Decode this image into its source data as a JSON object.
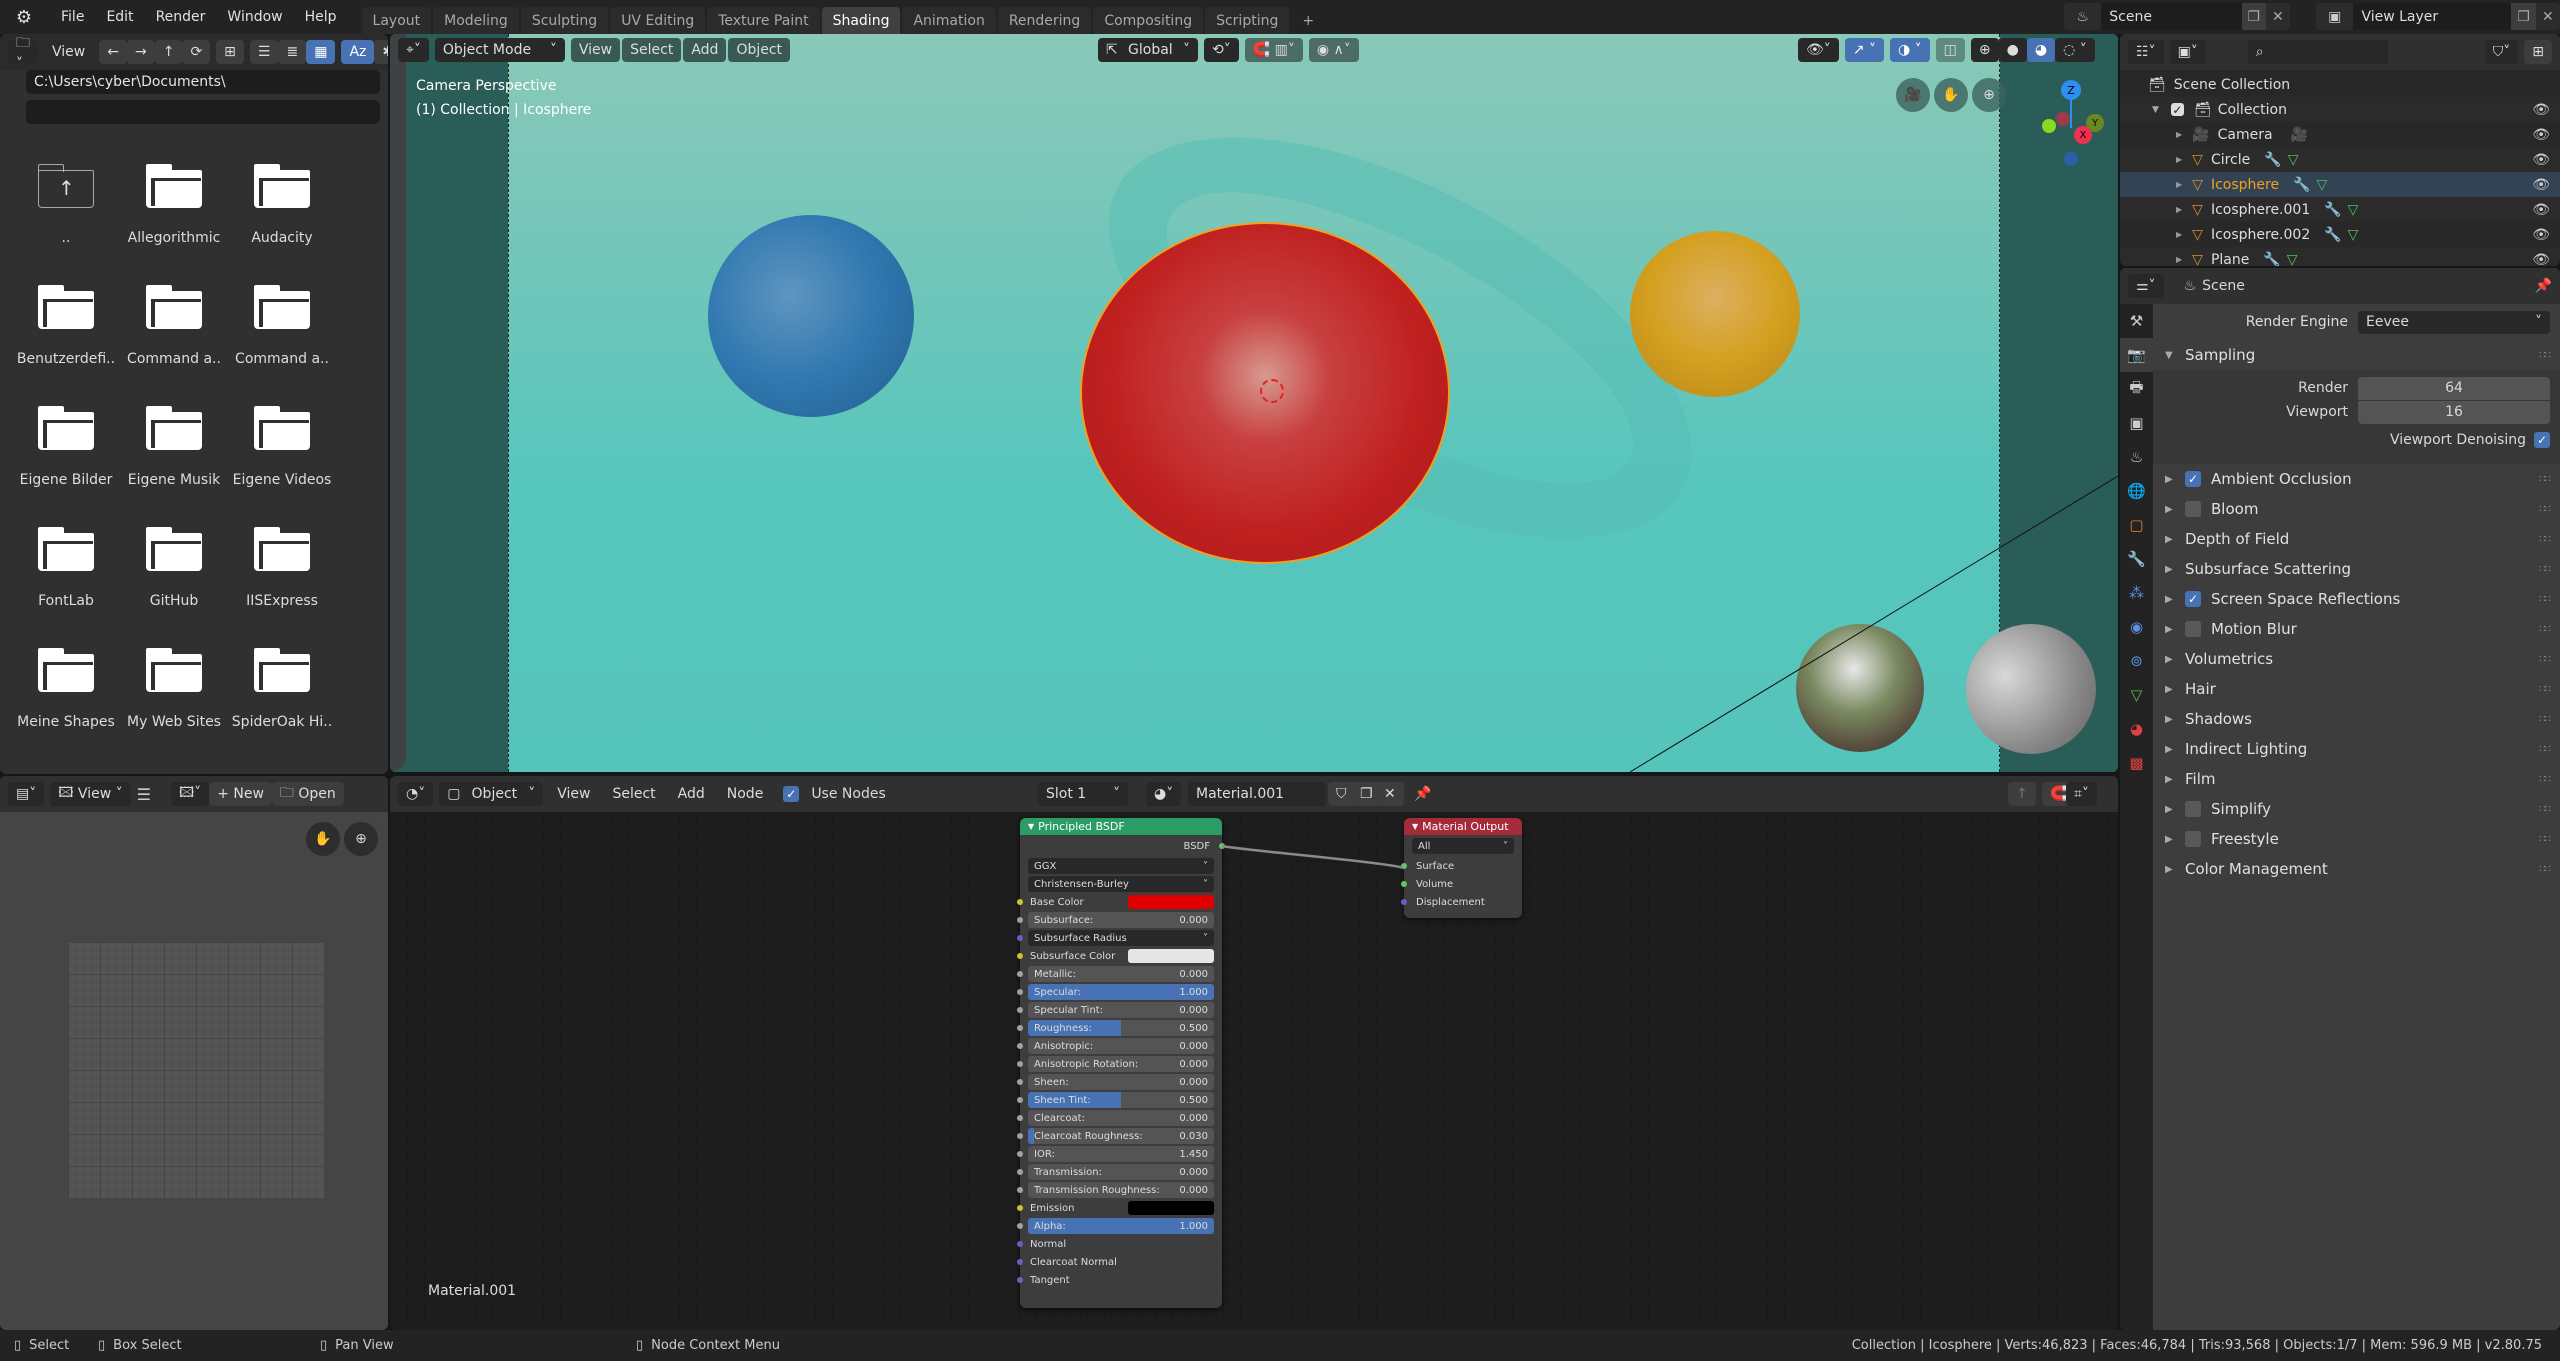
{
  "app": {
    "logo_icon": "blender-logo"
  },
  "menu": [
    "File",
    "Edit",
    "Render",
    "Window",
    "Help"
  ],
  "workspaces": {
    "tabs": [
      "Layout",
      "Modeling",
      "Sculpting",
      "UV Editing",
      "Texture Paint",
      "Shading",
      "Animation",
      "Rendering",
      "Compositing",
      "Scripting"
    ],
    "active": "Shading",
    "add_label": "+"
  },
  "scene_selector": {
    "value": "Scene"
  },
  "view_layer_selector": {
    "value": "View Layer"
  },
  "file_browser": {
    "header_view": "View",
    "path": "C:\\Users\\cyber\\Documents\\",
    "filename": "",
    "items": [
      {
        "name": "..",
        "type": "parent"
      },
      {
        "name": "Allegorithmic",
        "type": "folder"
      },
      {
        "name": "Audacity",
        "type": "folder"
      },
      {
        "name": "Benutzerdefi..",
        "type": "folder"
      },
      {
        "name": "Command a..",
        "type": "folder"
      },
      {
        "name": "Command a..",
        "type": "folder"
      },
      {
        "name": "Eigene Bilder",
        "type": "folder"
      },
      {
        "name": "Eigene Musik",
        "type": "folder"
      },
      {
        "name": "Eigene Videos",
        "type": "folder"
      },
      {
        "name": "FontLab",
        "type": "folder"
      },
      {
        "name": "GitHub",
        "type": "folder"
      },
      {
        "name": "IISExpress",
        "type": "folder"
      },
      {
        "name": "Meine Shapes",
        "type": "folder"
      },
      {
        "name": "My Web Sites",
        "type": "folder"
      },
      {
        "name": "SpiderOak Hi..",
        "type": "folder"
      }
    ]
  },
  "viewport": {
    "mode": "Object Mode",
    "menus": [
      "View",
      "Select",
      "Add",
      "Object"
    ],
    "orientation": "Global",
    "overlay_line1": "Camera Perspective",
    "overlay_line2": "(1) Collection | Icosphere",
    "gizmo_axes": [
      "Z",
      "Y",
      "X"
    ],
    "colors": {
      "red_sphere": "#c82020",
      "blue_sphere": "#2f78b0",
      "yellow_sphere": "#d4a020",
      "background": "#57c6bd"
    }
  },
  "outliner": {
    "root": "Scene Collection",
    "collection": "Collection",
    "objects": [
      {
        "name": "Camera",
        "type": "camera",
        "active": false
      },
      {
        "name": "Circle",
        "type": "mesh",
        "active": false
      },
      {
        "name": "Icosphere",
        "type": "mesh",
        "active": true
      },
      {
        "name": "Icosphere.001",
        "type": "mesh",
        "active": false
      },
      {
        "name": "Icosphere.002",
        "type": "mesh",
        "active": false
      },
      {
        "name": "Plane",
        "type": "mesh",
        "active": false
      }
    ]
  },
  "properties": {
    "context": "Scene",
    "render_engine_label": "Render Engine",
    "render_engine": "Eevee",
    "sampling": {
      "title": "Sampling",
      "render_label": "Render",
      "render": "64",
      "viewport_label": "Viewport",
      "viewport": "16",
      "denoise_label": "Viewport Denoising",
      "denoise": true
    },
    "sections": [
      {
        "label": "Ambient Occlusion",
        "checkbox": true,
        "checked": true
      },
      {
        "label": "Bloom",
        "checkbox": true,
        "checked": false
      },
      {
        "label": "Depth of Field",
        "checkbox": false
      },
      {
        "label": "Subsurface Scattering",
        "checkbox": false
      },
      {
        "label": "Screen Space Reflections",
        "checkbox": true,
        "checked": true
      },
      {
        "label": "Motion Blur",
        "checkbox": true,
        "checked": false
      },
      {
        "label": "Volumetrics",
        "checkbox": false
      },
      {
        "label": "Hair",
        "checkbox": false
      },
      {
        "label": "Shadows",
        "checkbox": false
      },
      {
        "label": "Indirect Lighting",
        "checkbox": false
      },
      {
        "label": "Film",
        "checkbox": false
      },
      {
        "label": "Simplify",
        "checkbox": true,
        "checked": false
      },
      {
        "label": "Freestyle",
        "checkbox": true,
        "checked": false
      },
      {
        "label": "Color Management",
        "checkbox": false
      }
    ]
  },
  "image_editor": {
    "view": "View",
    "new": "New",
    "open": "Open"
  },
  "node_editor": {
    "object": "Object",
    "menus": [
      "View",
      "Select",
      "Add",
      "Node"
    ],
    "use_nodes_label": "Use Nodes",
    "use_nodes": true,
    "slot": "Slot 1",
    "material": "Material.001",
    "material_label": "Material.001",
    "bsdf": {
      "title": "Principled BSDF",
      "output": "BSDF",
      "distribution": "GGX",
      "subsurface_method": "Christensen-Burley",
      "inputs": [
        {
          "label": "Base Color",
          "kind": "color",
          "color": "#e00000",
          "socket": "#c7c729"
        },
        {
          "label": "Subsurface:",
          "kind": "value",
          "value": "0.000",
          "fraction": 0,
          "socket": "#a1a1a1"
        },
        {
          "label": "Subsurface Radius",
          "kind": "dropdown",
          "socket": "#6363c7"
        },
        {
          "label": "Subsurface Color",
          "kind": "color",
          "color": "#e6e6e6",
          "socket": "#c7c729"
        },
        {
          "label": "Metallic:",
          "kind": "value",
          "value": "0.000",
          "fraction": 0,
          "socket": "#a1a1a1"
        },
        {
          "label": "Specular:",
          "kind": "value",
          "value": "1.000",
          "fraction": 1,
          "socket": "#a1a1a1"
        },
        {
          "label": "Specular Tint:",
          "kind": "value",
          "value": "0.000",
          "fraction": 0,
          "socket": "#a1a1a1"
        },
        {
          "label": "Roughness:",
          "kind": "value",
          "value": "0.500",
          "fraction": 0.5,
          "socket": "#a1a1a1"
        },
        {
          "label": "Anisotropic:",
          "kind": "value",
          "value": "0.000",
          "fraction": 0,
          "socket": "#a1a1a1"
        },
        {
          "label": "Anisotropic Rotation:",
          "kind": "value",
          "value": "0.000",
          "fraction": 0,
          "socket": "#a1a1a1"
        },
        {
          "label": "Sheen:",
          "kind": "value",
          "value": "0.000",
          "fraction": 0,
          "socket": "#a1a1a1"
        },
        {
          "label": "Sheen Tint:",
          "kind": "value",
          "value": "0.500",
          "fraction": 0.5,
          "socket": "#a1a1a1"
        },
        {
          "label": "Clearcoat:",
          "kind": "value",
          "value": "0.000",
          "fraction": 0,
          "socket": "#a1a1a1"
        },
        {
          "label": "Clearcoat Roughness:",
          "kind": "value",
          "value": "0.030",
          "fraction": 0.03,
          "socket": "#a1a1a1"
        },
        {
          "label": "IOR:",
          "kind": "value",
          "value": "1.450",
          "fraction": 0,
          "socket": "#a1a1a1"
        },
        {
          "label": "Transmission:",
          "kind": "value",
          "value": "0.000",
          "fraction": 0,
          "socket": "#a1a1a1"
        },
        {
          "label": "Transmission Roughness:",
          "kind": "value",
          "value": "0.000",
          "fraction": 0,
          "socket": "#a1a1a1"
        },
        {
          "label": "Emission",
          "kind": "color",
          "color": "#000000",
          "socket": "#c7c729"
        },
        {
          "label": "Alpha:",
          "kind": "value",
          "value": "1.000",
          "fraction": 1,
          "socket": "#a1a1a1"
        },
        {
          "label": "Normal",
          "kind": "socket",
          "socket": "#6363c7"
        },
        {
          "label": "Clearcoat Normal",
          "kind": "socket",
          "socket": "#6363c7"
        },
        {
          "label": "Tangent",
          "kind": "socket",
          "socket": "#6363c7"
        }
      ]
    },
    "output_node": {
      "title": "Material Output",
      "target": "All",
      "inputs": [
        {
          "label": "Surface",
          "socket": "#63c763"
        },
        {
          "label": "Volume",
          "socket": "#63c763"
        },
        {
          "label": "Displacement",
          "socket": "#6363c7"
        }
      ]
    }
  },
  "status_bar": {
    "hints": [
      {
        "icon": "mouse-left-icon",
        "label": "Select"
      },
      {
        "icon": "mouse-drag-icon",
        "label": "Box Select"
      },
      {
        "icon": "mouse-middle-icon",
        "label": "Pan View"
      },
      {
        "icon": "mouse-right-icon",
        "label": "Node Context Menu"
      }
    ],
    "stats": "Collection | Icosphere | Verts:46,823 | Faces:46,784 | Tris:93,568 | Objects:1/7 | Mem: 596.9 MB | v2.80.75"
  }
}
